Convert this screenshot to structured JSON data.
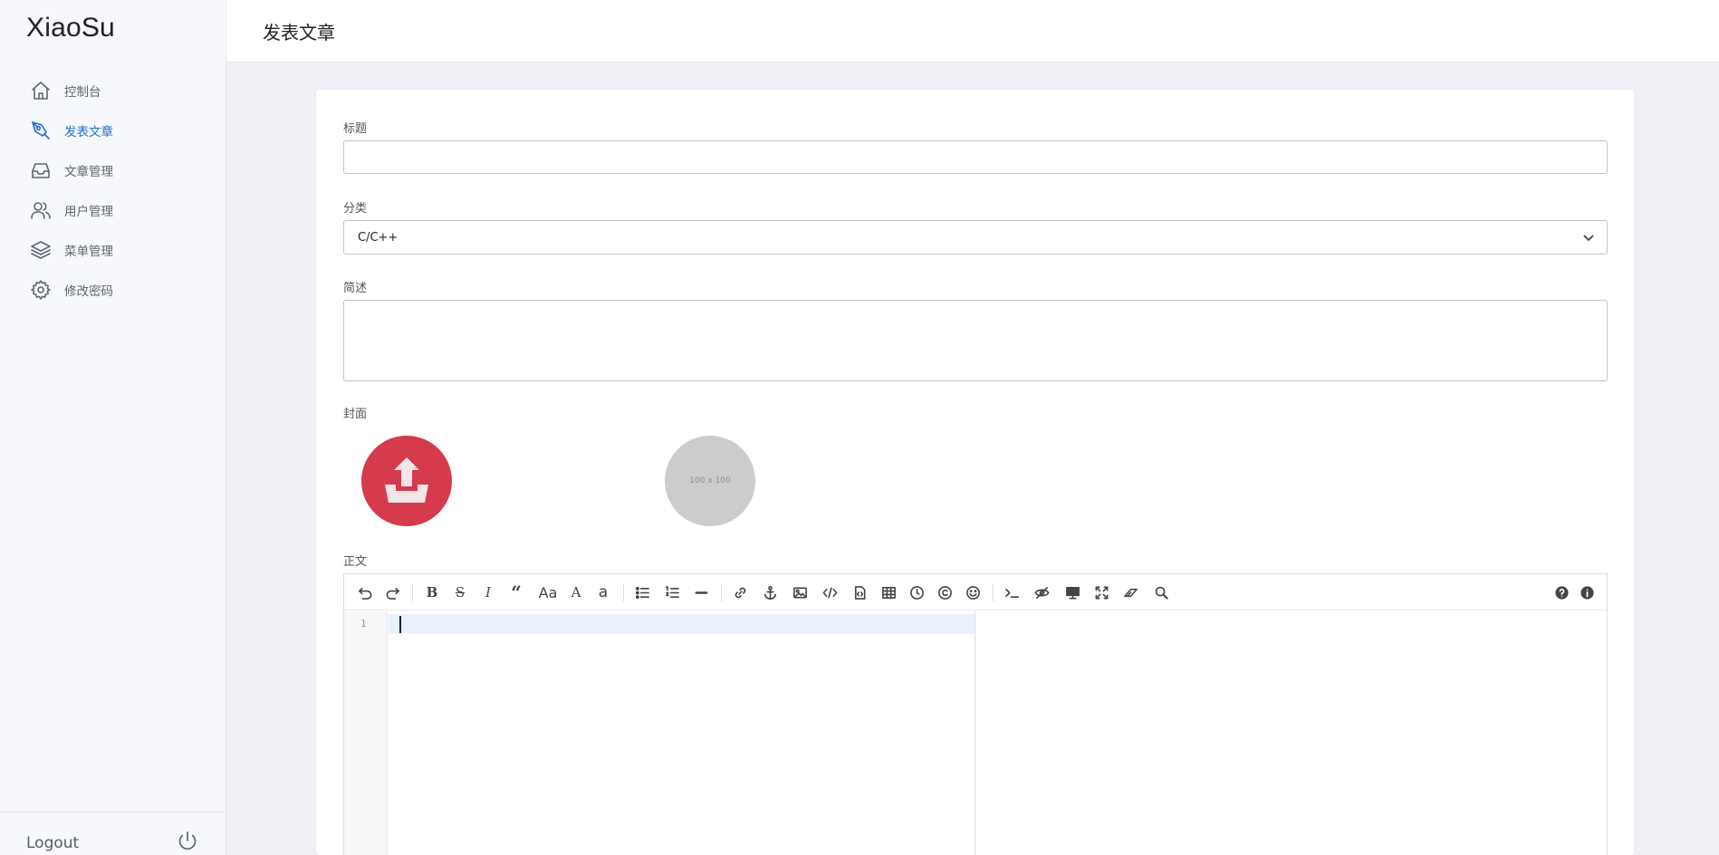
{
  "app": {
    "brand": "XiaoSu"
  },
  "sidebar": {
    "items": [
      {
        "label": "控制台",
        "icon": "home-icon",
        "active": false
      },
      {
        "label": "发表文章",
        "icon": "pen-nib-icon",
        "active": true
      },
      {
        "label": "文章管理",
        "icon": "inbox-icon",
        "active": false
      },
      {
        "label": "用户管理",
        "icon": "users-icon",
        "active": false
      },
      {
        "label": "菜单管理",
        "icon": "layers-icon",
        "active": false
      },
      {
        "label": "修改密码",
        "icon": "gear-icon",
        "active": false
      }
    ],
    "logout_label": "Logout"
  },
  "header": {
    "title": "发表文章"
  },
  "form": {
    "title_label": "标题",
    "title_value": "",
    "category_label": "分类",
    "category_value": "C/C++",
    "summary_label": "简述",
    "summary_value": "",
    "cover_label": "封面",
    "cover_placeholder_text": "100 x 100",
    "body_label": "正文"
  },
  "editor": {
    "line_numbers": [
      "1"
    ],
    "toolbar": [
      "undo",
      "redo",
      "bold",
      "strikethrough",
      "italic",
      "quote",
      "uppercase-first",
      "uppercase",
      "lowercase",
      "unordered-list",
      "ordered-list",
      "horizontal-rule",
      "link",
      "anchor",
      "image",
      "code",
      "preformatted-code",
      "table",
      "datetime",
      "html-entities",
      "emoji",
      "goto-line",
      "watch",
      "preview",
      "fullscreen",
      "clear",
      "search",
      "help",
      "info"
    ]
  },
  "colors": {
    "accent": "#1f6fd1",
    "upload": "#d53a4d"
  }
}
